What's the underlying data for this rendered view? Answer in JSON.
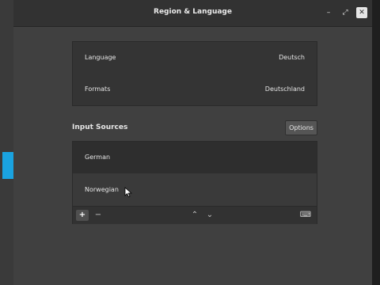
{
  "window": {
    "title": "Region & Language"
  },
  "titlebar": {
    "minimize": "–",
    "maximize": "⤢",
    "close": "✕"
  },
  "settings": [
    {
      "label": "Language",
      "value": "Deutsch"
    },
    {
      "label": "Formats",
      "value": "Deutschland"
    }
  ],
  "input_sources": {
    "title": "Input Sources",
    "options_label": "Options",
    "items": [
      {
        "label": "German"
      },
      {
        "label": "Norwegian"
      }
    ]
  },
  "toolbar": {
    "add": "+",
    "remove": "−",
    "up": "⌃",
    "down": "⌄",
    "keyboard": "⌨"
  },
  "colors": {
    "accent": "#1aa3e0"
  }
}
